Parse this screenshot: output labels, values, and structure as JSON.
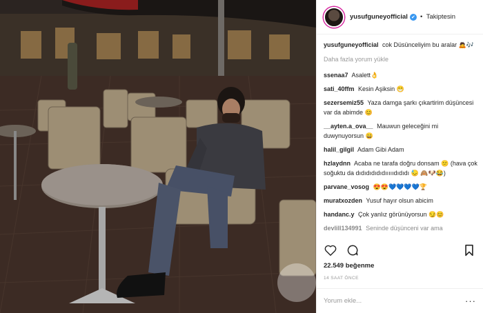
{
  "header": {
    "username": "yusufguneyofficial",
    "verified_glyph": "✔",
    "separator": "•",
    "follow_label": "Takiptesin"
  },
  "caption": {
    "username": "yusufguneyofficial",
    "text": "cok Düsünceliyim bu aralar 🙇🎶"
  },
  "load_more_label": "Daha fazla yorum yükle",
  "comments": [
    {
      "username": "ssenaa7",
      "text": "Asalett👌"
    },
    {
      "username": "sati_40ffm",
      "text": "Kesin Aşiksin 😁"
    },
    {
      "username": "sezersemiz55",
      "text": "Yaza damga şarkı çıkartirim düşüncesi var da abimde 😊"
    },
    {
      "username": "__ayten.a_ova__",
      "text": "Mauwun geleceğini mi duwynuyorsun 😄"
    },
    {
      "username": "halil_gilgil",
      "text": "Adam Gibi Adam"
    },
    {
      "username": "hzlaydnn",
      "text": "Acaba ne tarafa doğru donsam 😕 (hava çok soğuktu da dıdıdıdıdıdıııııdıdıdı 😓 🙈🐶😂)"
    },
    {
      "username": "parvane_vosog",
      "text": "😍😍💙💙💙💙🏆"
    },
    {
      "username": "muratxozden",
      "text": "Yusuf hayır olsun abicim"
    },
    {
      "username": "handanc.y",
      "text": "Çok yanlız görünüyorsun 😏😊"
    },
    {
      "username": "devlill134991",
      "text": "Seninde düşünceni var ama"
    }
  ],
  "icons": {
    "like": "heart-icon",
    "comment": "comment-icon",
    "bookmark": "bookmark-icon",
    "options": "more-options-icon"
  },
  "likes": "22.549 beğenme",
  "timestamp": "14 SAAT ÖNCE",
  "add_comment": {
    "placeholder": "Yorum ekle...",
    "options_glyph": "···"
  }
}
